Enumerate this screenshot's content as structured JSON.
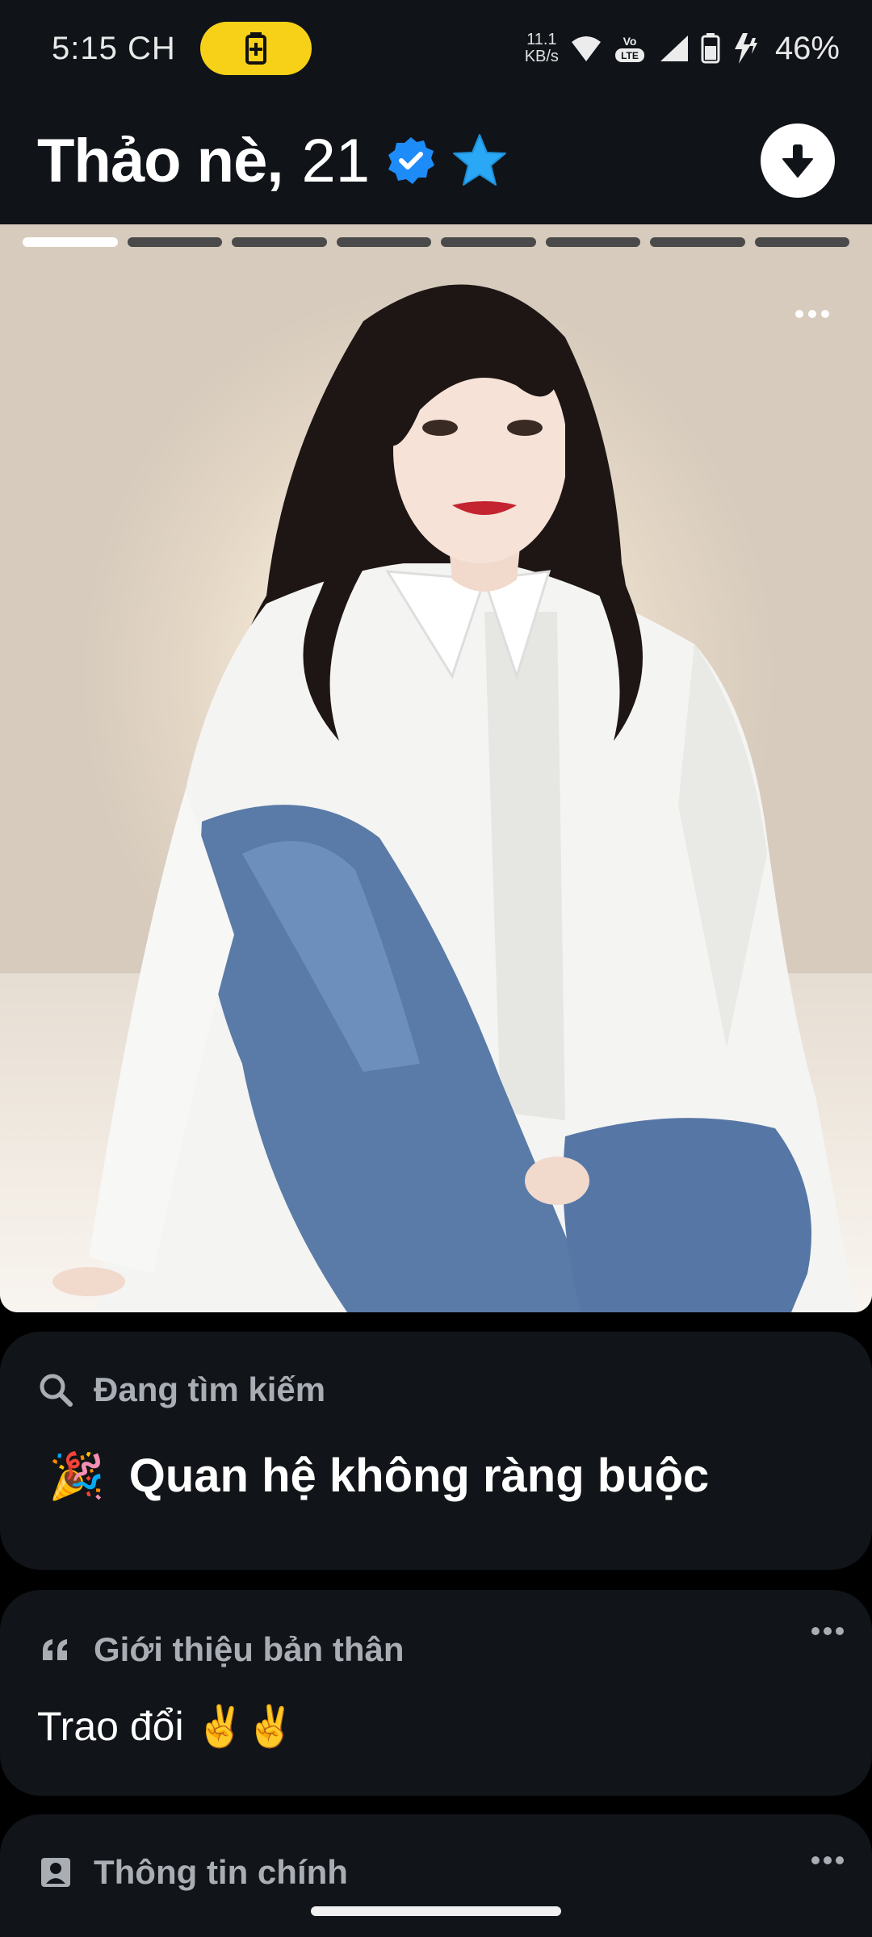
{
  "status_bar": {
    "time": "5:15 CH",
    "net_speed_value": "11.1",
    "net_speed_unit": "KB/s",
    "battery_percent": "46%",
    "icons": [
      "battery-saver-icon",
      "wifi-icon",
      "volte-icon",
      "signal-icon",
      "battery-icon",
      "charging-icon"
    ]
  },
  "profile": {
    "name": "Thảo nè",
    "comma": ",",
    "age": "21",
    "badges": [
      "verified-icon",
      "star-icon"
    ],
    "collapse_icon": "arrow-down-icon"
  },
  "photo": {
    "total": 8,
    "current": 1,
    "more_icon": "more-horizontal-icon"
  },
  "looking_for": {
    "label": "Đang tìm kiếm",
    "emoji": "🎉",
    "value": "Quan hệ không ràng buộc"
  },
  "bio": {
    "label": "Giới thiệu bản thân",
    "text": "Trao đổi ✌️✌️"
  },
  "main_info": {
    "label": "Thông tin chính"
  },
  "colors": {
    "background": "#000000",
    "card": "#111418",
    "header": "#101419",
    "battery_pill": "#f7d117",
    "verified": "#1d8cf8",
    "star": "#2aa7f5",
    "label": "#a9adb4"
  }
}
